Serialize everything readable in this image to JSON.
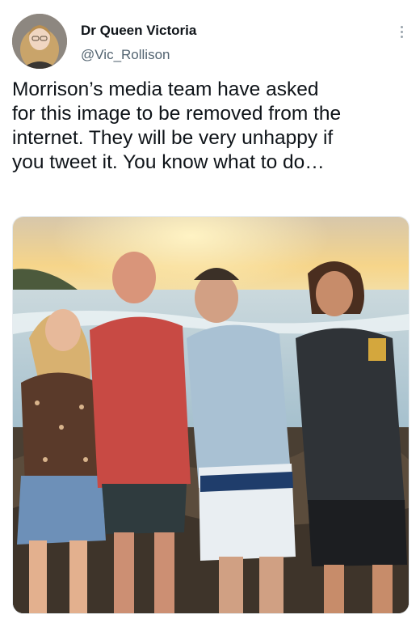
{
  "tweet": {
    "author": {
      "display_name": "Dr Queen Victoria",
      "handle": "@Vic_Rollison",
      "avatar_icon": "profile-photo"
    },
    "more_icon": "more-vertical-icon",
    "text": "Morrison’s media team have asked\nfor this image to be removed from the\ninternet. They will be very unhappy if\nyou tweet it. You know what to do…",
    "media": {
      "type": "photo",
      "colors": {
        "sky_top": "#c9b89c",
        "sunset": "#f6d58a",
        "sea": "#b9cfd8",
        "rocks": "#4a3f33"
      }
    }
  }
}
